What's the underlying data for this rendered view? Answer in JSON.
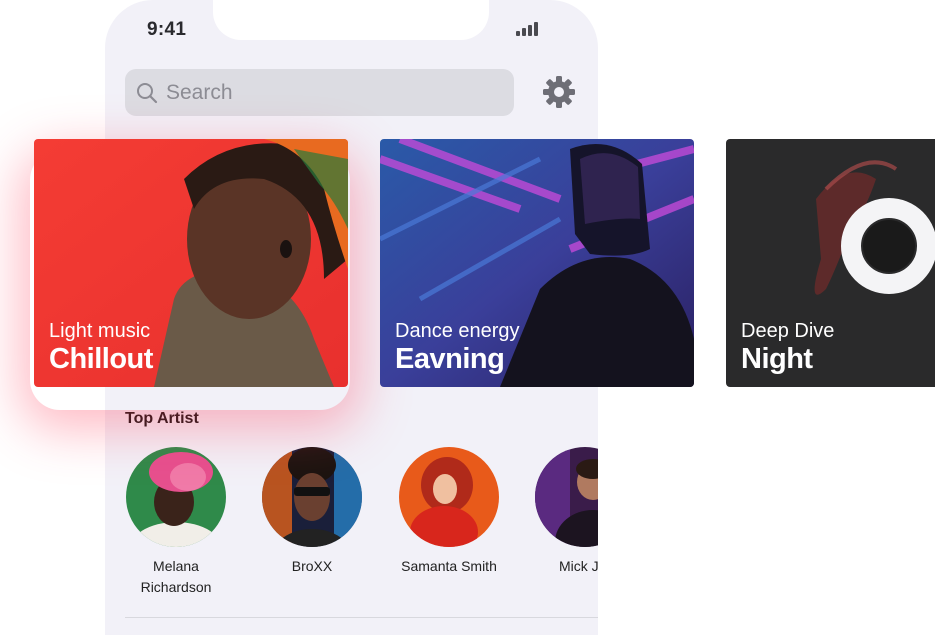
{
  "status_bar": {
    "time": "9:41"
  },
  "search": {
    "placeholder": "Search"
  },
  "cards": [
    {
      "subtitle": "Light music",
      "title": "Chillout"
    },
    {
      "subtitle": "Dance energy",
      "title": "Eavning"
    },
    {
      "subtitle": "Deep Dive",
      "title": "Night"
    }
  ],
  "top_artist": {
    "heading": "Top Artist",
    "artists": [
      {
        "name_line1": "Melana",
        "name_line2": "Richardson"
      },
      {
        "name_line1": "BroXX",
        "name_line2": ""
      },
      {
        "name_line1": "Samanta Smith",
        "name_line2": ""
      },
      {
        "name_line1": "Mick Jor",
        "name_line2": ""
      }
    ]
  },
  "icons": {
    "search": "search-icon",
    "settings": "gear-icon",
    "signal": "signal-icon"
  },
  "colors": {
    "card1": "#f03a36",
    "card2": "#2e3d8c",
    "card3": "#2b2b2b",
    "glow": "#ff3c5a"
  }
}
